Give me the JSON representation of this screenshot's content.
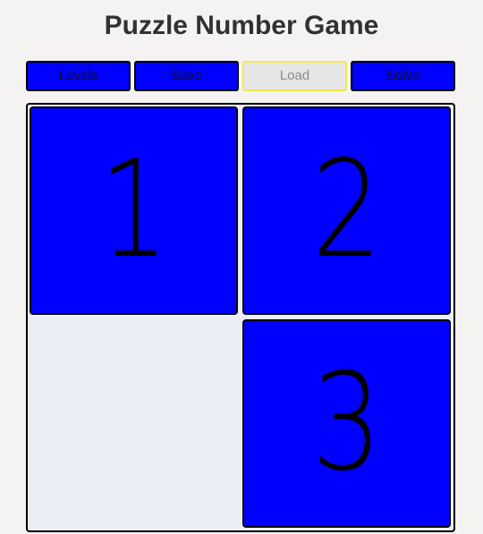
{
  "title": "Puzzle Number Game",
  "toolbar": {
    "buttons": [
      {
        "label": "Levels",
        "enabled": true
      },
      {
        "label": "Save",
        "enabled": true
      },
      {
        "label": "Load",
        "enabled": false
      },
      {
        "label": "Solve",
        "enabled": true
      }
    ]
  },
  "board": {
    "rows": 2,
    "cols": 2,
    "cells": [
      "1",
      "2",
      "",
      "3"
    ],
    "tile_color": "#0000ff",
    "empty_color": "#ebeef5"
  }
}
